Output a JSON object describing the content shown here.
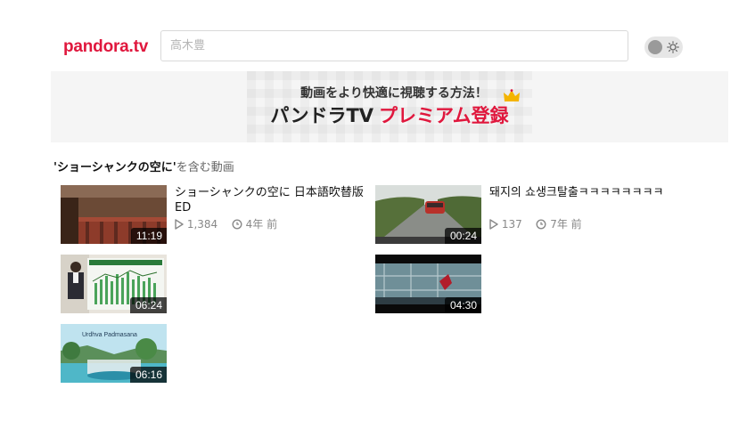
{
  "header": {
    "logo": "pandora.tv",
    "search_placeholder": "高木豊"
  },
  "banner": {
    "subtitle": "動画をより快適に視聴する方法！",
    "title_dark": "パンドラTV",
    "title_red": "プレミアム登録"
  },
  "results": {
    "quote_open": "'",
    "query": "ショーシャンクの空に",
    "quote_close": "'",
    "suffix": "を含む動画"
  },
  "videos": [
    {
      "duration": "11:19",
      "title": "ショーシャンクの空に 日本語吹替版ED",
      "views": "1,384",
      "age": "4年 前"
    },
    {
      "duration": "00:24",
      "title": "돼지의 쇼생크탈출ㅋㅋㅋㅋㅋㅋㅋㅋ",
      "views": "137",
      "age": "7年 前"
    },
    {
      "duration": "06:24"
    },
    {
      "duration": "04:30"
    },
    {
      "duration": "06:16",
      "overlay_text": "Urdhva Padmasana"
    }
  ],
  "colors": {
    "brand": "#e0173d"
  }
}
